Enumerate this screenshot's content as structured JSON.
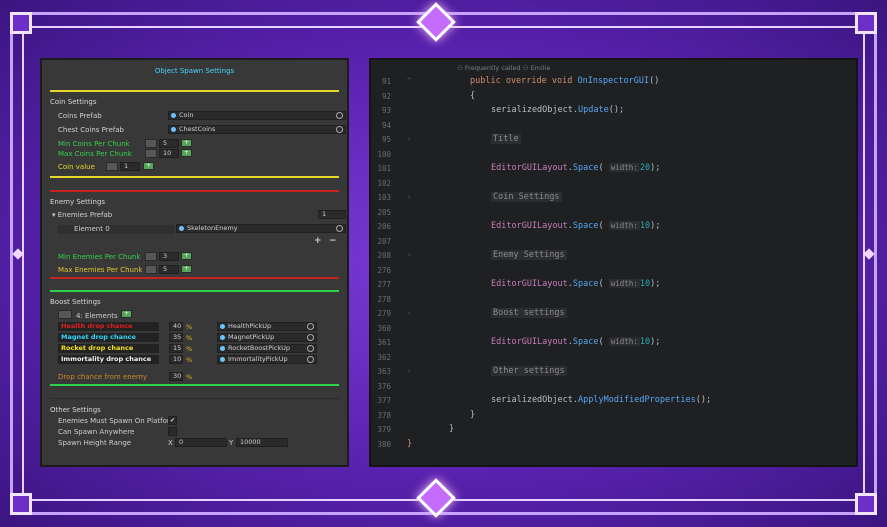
{
  "inspector": {
    "title": "Object Spawn Settings",
    "coin": {
      "section_title": "Coin Settings",
      "coins_prefab_label": "Coins Prefab",
      "coins_prefab_value": "Coin",
      "chest_coins_label": "Chest Coins Prefab",
      "chest_coins_value": "ChestCoins",
      "min_label": "Min Coins Per Chunk",
      "min_value": "5",
      "max_label": "Max Coins Per Chunk",
      "max_value": "10",
      "coin_value_label": "Coin value",
      "coin_value": "1"
    },
    "enemy": {
      "section_title": "Enemy Settings",
      "prefab_label": "Enemies Prefab",
      "prefab_count": "1",
      "element_label": "Element 0",
      "element_value": "SkeletonEnemy",
      "add_label": "+",
      "remove_label": "−",
      "min_label": "Min Enemies Per Chunk",
      "min_value": "3",
      "max_label": "Max Enemies Per Chunk",
      "max_value": "5"
    },
    "boost": {
      "section_title": "Boost Settings",
      "elements_label": "4: Elements",
      "rows": [
        {
          "label": "Health drop chance",
          "value": "40",
          "pct": "%",
          "prefab": "HealthPickUp",
          "color": "#e02020"
        },
        {
          "label": "Magnet drop chance",
          "value": "35",
          "pct": "%",
          "prefab": "MagnetPickUp",
          "color": "#2fd7ff"
        },
        {
          "label": "Rocket drop chance",
          "value": "15",
          "pct": "%",
          "prefab": "RocketBoostPickUp",
          "color": "#f5e31b"
        },
        {
          "label": "Immortality drop chance",
          "value": "10",
          "pct": "%",
          "prefab": "ImmortalityPickUp",
          "color": "#f2f2f2"
        }
      ],
      "drop_enemy_label": "Drop chance from enemy",
      "drop_enemy_value": "30",
      "drop_enemy_pct": "%"
    },
    "other": {
      "section_title": "Other Settings",
      "platform_label": "Enemies Must Spawn On Platform",
      "platform_check": "✔",
      "anywhere_label": "Can Spawn Anywhere",
      "height_label": "Spawn Height Range",
      "x_label": "X",
      "x_value": "0",
      "y_label": "Y",
      "y_value": "10000"
    },
    "colors": {
      "coin_sep": "#e6d52a",
      "enemy_sep": "#c62222",
      "boost_sep": "#2ed14a",
      "green_label": "#34d24a",
      "yellow_label": "#e6c62a",
      "red_label": "#e03a2a"
    }
  },
  "editor": {
    "hint_top": "⚇ Frequently called   ⚇ Emilie",
    "lines": [
      {
        "n": "91",
        "fold": "^",
        "tokens": [
          [
            "kw",
            "public override void "
          ],
          [
            "fn",
            "OnInspectorGUI"
          ],
          [
            "p",
            "()"
          ]
        ],
        "indent": 3
      },
      {
        "n": "92",
        "fold": "",
        "tokens": [
          [
            "p",
            "{"
          ]
        ],
        "indent": 3
      },
      {
        "n": "93",
        "fold": "",
        "tokens": [
          [
            "p",
            "serializedObject."
          ],
          [
            "fn",
            "Update"
          ],
          [
            "p",
            "();"
          ]
        ],
        "indent": 4
      },
      {
        "n": "94",
        "fold": "",
        "tokens": [],
        "indent": 0
      },
      {
        "n": "95",
        "fold": "›",
        "tokens": [
          [
            "region",
            "Title"
          ]
        ],
        "indent": 4
      },
      {
        "n": "100",
        "fold": "",
        "tokens": [],
        "indent": 0
      },
      {
        "n": "101",
        "fold": "",
        "tokens": [
          [
            "ty",
            "EditorGUILayout"
          ],
          [
            "p",
            "."
          ],
          [
            "fn",
            "Space"
          ],
          [
            "p",
            "( "
          ],
          [
            "hint",
            "width:"
          ],
          [
            "num",
            "20"
          ],
          [
            "p",
            ");"
          ]
        ],
        "indent": 4
      },
      {
        "n": "102",
        "fold": "",
        "tokens": [],
        "indent": 0
      },
      {
        "n": "103",
        "fold": "›",
        "tokens": [
          [
            "region",
            "Coin Settings"
          ]
        ],
        "indent": 4
      },
      {
        "n": "205",
        "fold": "",
        "tokens": [],
        "indent": 0
      },
      {
        "n": "206",
        "fold": "",
        "tokens": [
          [
            "ty",
            "EditorGUILayout"
          ],
          [
            "p",
            "."
          ],
          [
            "fn",
            "Space"
          ],
          [
            "p",
            "( "
          ],
          [
            "hint",
            "width:"
          ],
          [
            "num",
            "10"
          ],
          [
            "p",
            ");"
          ]
        ],
        "indent": 4
      },
      {
        "n": "207",
        "fold": "",
        "tokens": [],
        "indent": 0
      },
      {
        "n": "208",
        "fold": "›",
        "tokens": [
          [
            "region",
            "Enemy Settings"
          ]
        ],
        "indent": 4
      },
      {
        "n": "276",
        "fold": "",
        "tokens": [],
        "indent": 0
      },
      {
        "n": "277",
        "fold": "",
        "tokens": [
          [
            "ty",
            "EditorGUILayout"
          ],
          [
            "p",
            "."
          ],
          [
            "fn",
            "Space"
          ],
          [
            "p",
            "( "
          ],
          [
            "hint",
            "width:"
          ],
          [
            "num",
            "10"
          ],
          [
            "p",
            ");"
          ]
        ],
        "indent": 4
      },
      {
        "n": "278",
        "fold": "",
        "tokens": [],
        "indent": 0
      },
      {
        "n": "279",
        "fold": "›",
        "tokens": [
          [
            "region",
            "Boost settings"
          ]
        ],
        "indent": 4
      },
      {
        "n": "360",
        "fold": "",
        "tokens": [],
        "indent": 0
      },
      {
        "n": "361",
        "fold": "",
        "tokens": [
          [
            "ty",
            "EditorGUILayout"
          ],
          [
            "p",
            "."
          ],
          [
            "fn",
            "Space"
          ],
          [
            "p",
            "( "
          ],
          [
            "hint",
            "width:"
          ],
          [
            "num",
            "10"
          ],
          [
            "p",
            ");"
          ]
        ],
        "indent": 4
      },
      {
        "n": "362",
        "fold": "",
        "tokens": [],
        "indent": 0
      },
      {
        "n": "363",
        "fold": "›",
        "tokens": [
          [
            "region",
            "Other settings"
          ]
        ],
        "indent": 4
      },
      {
        "n": "376",
        "fold": "",
        "tokens": [],
        "indent": 0
      },
      {
        "n": "377",
        "fold": "",
        "tokens": [
          [
            "p",
            "serializedObject."
          ],
          [
            "fn",
            "ApplyModifiedProperties"
          ],
          [
            "p",
            "();"
          ]
        ],
        "indent": 4
      },
      {
        "n": "378",
        "fold": "",
        "tokens": [
          [
            "p",
            "}"
          ]
        ],
        "indent": 3
      },
      {
        "n": "379",
        "fold": "",
        "tokens": [
          [
            "p",
            "}"
          ]
        ],
        "indent": 2
      },
      {
        "n": "380",
        "fold": "",
        "tokens": [
          [
            "kw",
            "}"
          ]
        ],
        "indent": 0
      }
    ]
  }
}
